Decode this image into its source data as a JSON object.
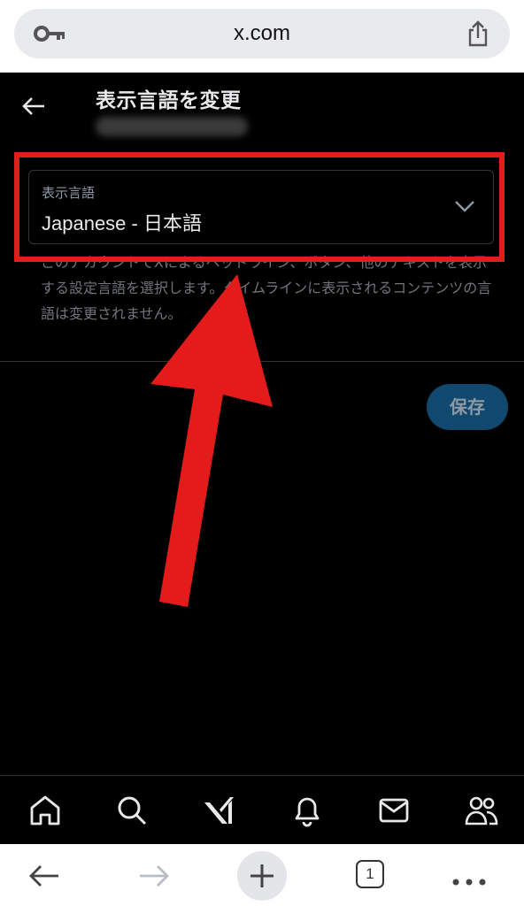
{
  "browser": {
    "url": "x.com",
    "open_tabs_count": "1"
  },
  "header": {
    "title": "表示言語を変更"
  },
  "language_select": {
    "label": "表示言語",
    "value": "Japanese - 日本語"
  },
  "description": "このアカウントでXによるヘッドライン、ボタン、他のテキストを表示する設定言語を選択します。タイムラインに表示されるコンテンツの言語は変更されません。",
  "save_label": "保存",
  "colors": {
    "background": "#000000",
    "save_button": "#10486f",
    "annotation_red": "#e01e1e"
  },
  "bottom_nav": [
    "home-icon",
    "search-icon",
    "grok-icon",
    "notifications-icon",
    "messages-icon",
    "communities-icon"
  ],
  "browser_toolbar": [
    "back-icon",
    "forward-icon",
    "new-tab-icon",
    "tabs-icon",
    "more-icon"
  ]
}
